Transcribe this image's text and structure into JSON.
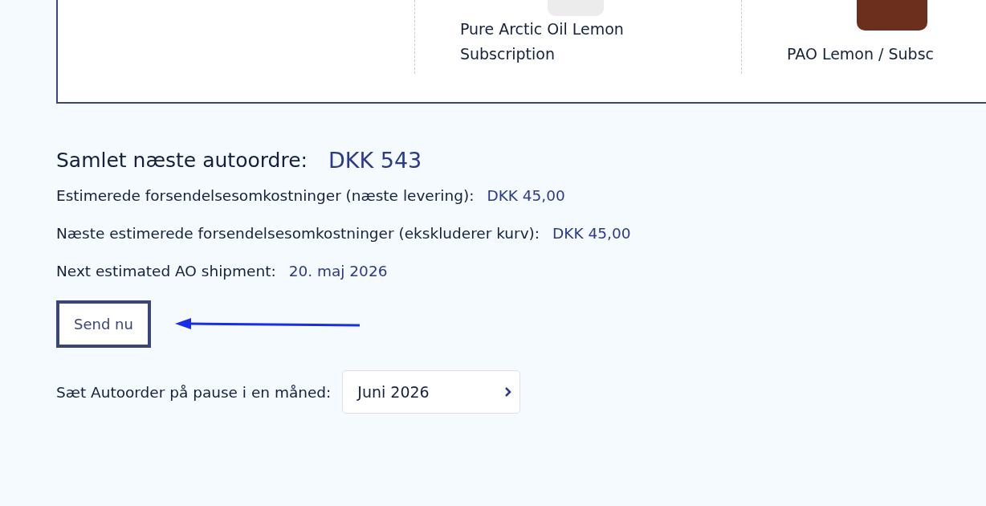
{
  "products": [
    {
      "name": "Pure Arctic Oil Lemon Subscription"
    },
    {
      "name": "PAO Lemon / Subsc"
    }
  ],
  "summary": {
    "title": "Samlet næste autoordre:",
    "total": "DKK 543"
  },
  "details": [
    {
      "label": "Estimerede forsendelsesomkostninger (næste levering):",
      "value": "DKK 45,00"
    },
    {
      "label": "Næste estimerede forsendelsesomkostninger (ekskluderer kurv):",
      "value": "DKK 45,00"
    },
    {
      "label": "Next estimated AO shipment:",
      "value": "20. maj 2026"
    }
  ],
  "send_button": "Send nu",
  "pause": {
    "label": "Sæt Autoorder på pause i en måned:",
    "value": "Juni 2026"
  }
}
